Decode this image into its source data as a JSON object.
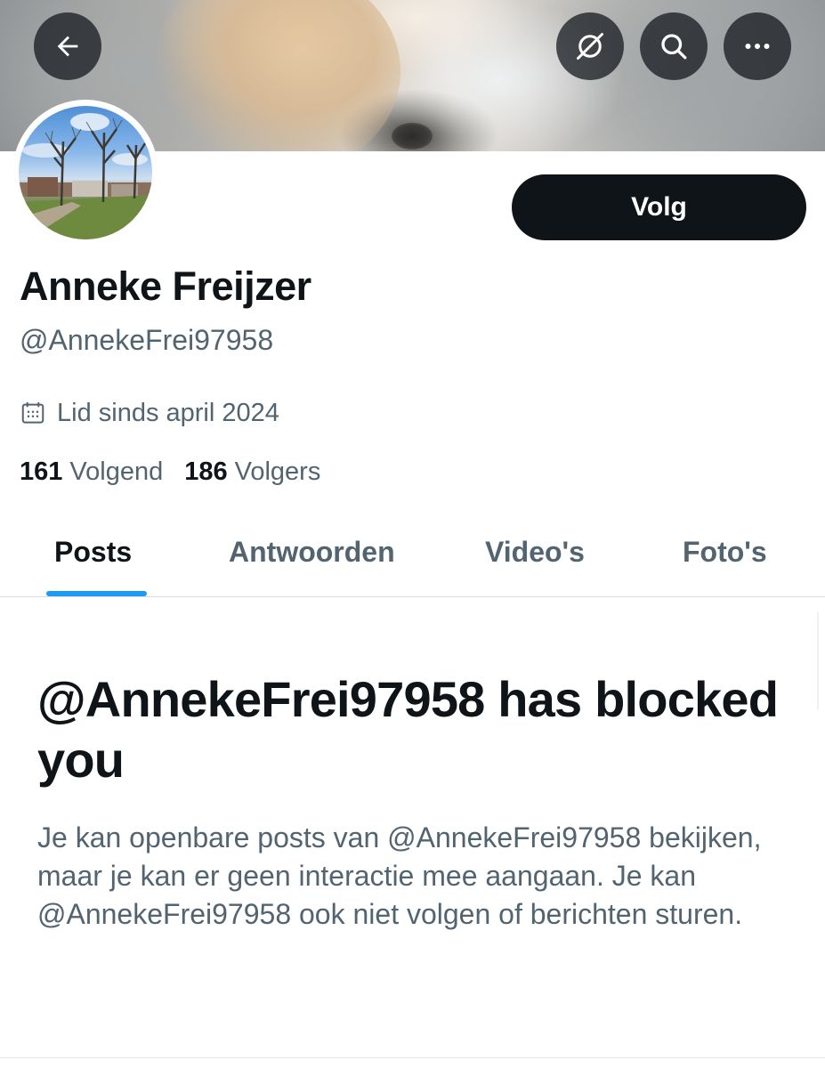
{
  "header": {
    "back_icon": "arrow-left-icon",
    "grok_icon": "grok-icon",
    "search_icon": "search-icon",
    "more_icon": "more-horizontal-icon"
  },
  "profile": {
    "follow_label": "Volg",
    "display_name": "Anneke Freijzer",
    "handle": "@AnnekeFrei97958",
    "joined": "Lid sinds april 2024",
    "following_count": "161",
    "following_label": "Volgend",
    "followers_count": "186",
    "followers_label": "Volgers"
  },
  "tabs": [
    {
      "label": "Posts"
    },
    {
      "label": "Antwoorden"
    },
    {
      "label": "Video's"
    },
    {
      "label": "Foto's"
    }
  ],
  "blocked": {
    "title": "@AnnekeFrei97958 has blocked you",
    "description": "Je kan openbare posts van @AnnekeFrei97958 bekijken, maar je kan er geen interactie mee aangaan. Je kan @AnnekeFrei97958 ook niet volgen of berichten sturen."
  },
  "colors": {
    "accent": "#1d9bf0",
    "text_primary": "#0f1419",
    "text_secondary": "#536471",
    "button_dark": "#0f1419"
  }
}
